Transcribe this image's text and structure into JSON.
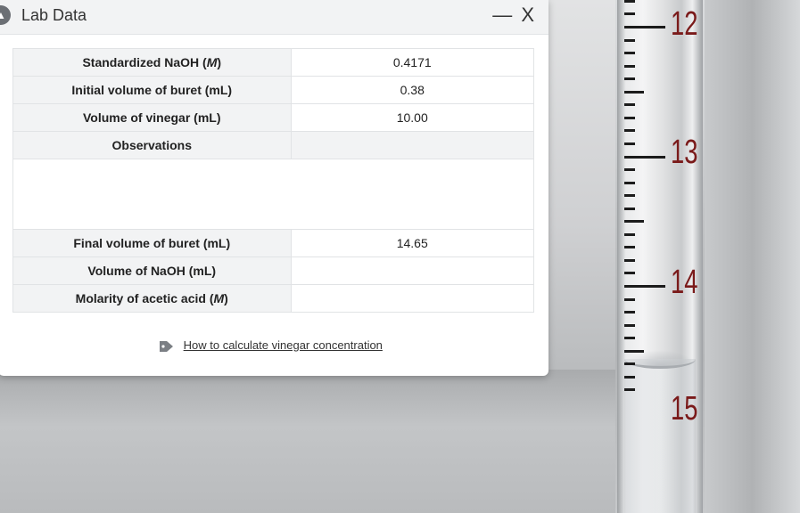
{
  "window": {
    "title": "Lab Data",
    "minimize_label": "—",
    "close_label": "X"
  },
  "table": {
    "rows": [
      {
        "label": "Standardized NaOH (M)",
        "value": "0.4171"
      },
      {
        "label": "Initial volume of buret (mL)",
        "value": "0.38"
      },
      {
        "label": "Volume of vinegar (mL)",
        "value": "10.00"
      },
      {
        "label": "Observations",
        "value": ""
      },
      {
        "label": "Final volume of buret (mL)",
        "value": "14.65"
      },
      {
        "label": "Volume of NaOH (mL)",
        "value": ""
      },
      {
        "label": "Molarity of acetic acid (M)",
        "value": ""
      }
    ]
  },
  "help": {
    "icon": "tag-icon",
    "link_text": "How to calculate vinegar concentration"
  },
  "buret": {
    "scale_numbers": [
      "12",
      "13",
      "14",
      "15"
    ],
    "liquid_level_mL": 14.65,
    "number_color": "#7a1a1a"
  }
}
